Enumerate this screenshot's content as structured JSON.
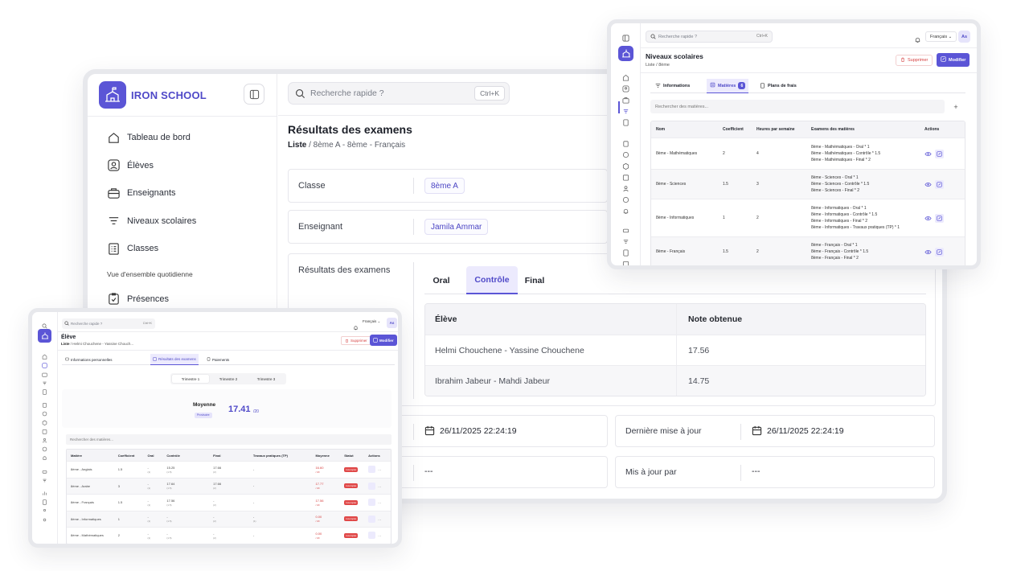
{
  "main": {
    "brand": "IRON SCHOOL",
    "nav": [
      {
        "label": "Tableau de bord",
        "icon": "home-icon"
      },
      {
        "label": "Élèves",
        "icon": "student-icon"
      },
      {
        "label": "Enseignants",
        "icon": "teacher-icon"
      },
      {
        "label": "Niveaux scolaires",
        "icon": "levels-icon"
      },
      {
        "label": "Classes",
        "icon": "classes-icon"
      }
    ],
    "nav_section": "Vue d'ensemble quotidienne",
    "nav_extra": {
      "label": "Présences",
      "icon": "clipboard-icon"
    },
    "search": {
      "placeholder": "Recherche rapide ?",
      "shortcut": "Ctrl+K"
    },
    "page_title": "Résultats des examens",
    "breadcrumb": {
      "root": "Liste",
      "rest": " / 8ème A - 8ème - Français"
    },
    "fields": [
      {
        "label": "Classe",
        "value": "8ème A"
      },
      {
        "label": "Enseignant",
        "value": "Jamila Ammar"
      }
    ],
    "results": {
      "label": "Résultats des examens",
      "tabs": [
        "Oral",
        "Contrôle",
        "Final"
      ],
      "active_tab": "Contrôle",
      "columns": [
        "Élève",
        "Note obtenue"
      ],
      "rows": [
        {
          "student": "Helmi Chouchene - Yassine Chouchene",
          "grade": "17.56"
        },
        {
          "student": "Ibrahim Jabeur - Mahdi Jabeur",
          "grade": "14.75"
        }
      ]
    },
    "meta": {
      "created_value": "26/11/2025 22:24:19",
      "updated_label": "Dernière mise à jour",
      "updated_value": "26/11/2025 22:24:19",
      "created_by_value": "---",
      "updated_by_label": "Mis à jour par",
      "updated_by_value": "---"
    }
  },
  "top_right": {
    "search": {
      "placeholder": "Recherche rapide ?",
      "shortcut": "Ctrl+K"
    },
    "language": "Français",
    "avatar": "As",
    "title": "Niveaux scolaires",
    "breadcrumb": "Liste / 8ème",
    "delete_label": "Supprimer",
    "edit_label": "Modifier",
    "tabs": [
      {
        "label": "Informations",
        "icon": "filter-icon"
      },
      {
        "label": "Matières",
        "icon": "book-icon",
        "count": "6"
      },
      {
        "label": "Plans de frais",
        "icon": "receipt-icon"
      }
    ],
    "active_tab": "Matières",
    "subject_search": "Rechercher des matières...",
    "columns": [
      "Nom",
      "Coefficient",
      "Heures par semaine",
      "Examens des matières",
      "Actions"
    ],
    "rows": [
      {
        "name": "8ème - Mathématiques",
        "coef": "2",
        "hours": "4",
        "exams": [
          "8ème - Mathématiques - Oral * 1",
          "8ème - Mathématiques - Contrôle * 1.5",
          "8ème - Mathématiques - Final * 2"
        ]
      },
      {
        "name": "8ème - Sciences",
        "coef": "1.5",
        "hours": "3",
        "exams": [
          "8ème - Sciences - Oral * 1",
          "8ème - Sciences - Contrôle * 1.5",
          "8ème - Sciences - Final * 2"
        ]
      },
      {
        "name": "8ème - Informatiques",
        "coef": "1",
        "hours": "2",
        "exams": [
          "8ème - Informatiques - Oral * 1",
          "8ème - Informatiques - Contrôle * 1.5",
          "8ème - Informatiques - Final * 2",
          "8ème - Informatiques - Travaux pratiques (TP) * 1"
        ]
      },
      {
        "name": "8ème - Français",
        "coef": "1.5",
        "hours": "2",
        "exams": [
          "8ème - Français - Oral * 1",
          "8ème - Français - Contrôle * 1.5",
          "8ème - Français - Final * 2"
        ]
      }
    ]
  },
  "bottom_left": {
    "search": {
      "placeholder": "Recherche rapide ?",
      "shortcut": "Ctrl+K"
    },
    "language": "Français",
    "avatar": "As",
    "title": "Élève",
    "breadcrumb_root": "Liste",
    "breadcrumb_rest": " / Helmi Chouchene - Yassine Chouch...",
    "delete_label": "Supprimer",
    "edit_label": "Modifier",
    "tabs": [
      {
        "label": "Informations personnelles",
        "icon": "id-icon"
      },
      {
        "label": "Résultats des examens",
        "icon": "results-icon"
      },
      {
        "label": "Paiements",
        "icon": "payment-icon"
      }
    ],
    "active_tab": "Résultats des examens",
    "trimesters": [
      "Trimestre 1",
      "Trimestre 2",
      "Trimestre 3"
    ],
    "active_trimester": "Trimestre 1",
    "average_label": "Moyenne",
    "average_badge": "Provisoire",
    "average_value": "17.41",
    "average_denominator": "/20",
    "subject_search": "Rechercher des matières...",
    "columns": [
      "Matière",
      "Coefficient",
      "Oral",
      "Contrôle",
      "Final",
      "Travaux pratiques (TP)",
      "Moyenne",
      "Statut",
      "Actions"
    ],
    "rows": [
      {
        "subject": "8ème - Anglais",
        "coef": "1.5",
        "oral": "-",
        "oral_sub": "(1)",
        "ctrl": "15.25",
        "ctrl_sub": "(1.5)",
        "final": "17.66",
        "final_sub": "(2)",
        "tp": "-",
        "tp_sub": "",
        "avg": "16.60",
        "avg_sub": "/ 20",
        "status": "Incomplet"
      },
      {
        "subject": "8ème - Arabe",
        "coef": "3",
        "oral": "-",
        "oral_sub": "(1)",
        "ctrl": "17.64",
        "ctrl_sub": "(1.5)",
        "final": "17.66",
        "final_sub": "(2)",
        "tp": "-",
        "tp_sub": "",
        "avg": "17.77",
        "avg_sub": "/ 20",
        "status": "Incomplet"
      },
      {
        "subject": "8ème - Français",
        "coef": "1.5",
        "oral": "-",
        "oral_sub": "(1)",
        "ctrl": "17.56",
        "ctrl_sub": "(1.5)",
        "final": "-",
        "final_sub": "(2)",
        "tp": "-",
        "tp_sub": "",
        "avg": "17.56",
        "avg_sub": "/ 20",
        "status": "Incomplet"
      },
      {
        "subject": "8ème - Informatiques",
        "coef": "1",
        "oral": "-",
        "oral_sub": "(1)",
        "ctrl": "-",
        "ctrl_sub": "(1.5)",
        "final": "-",
        "final_sub": "(2)",
        "tp": "-",
        "tp_sub": "(1)",
        "avg": "0.00",
        "avg_sub": "/ 20",
        "status": "Incomplet"
      },
      {
        "subject": "8ème - Mathématiques",
        "coef": "2",
        "oral": "-",
        "oral_sub": "(1)",
        "ctrl": "-",
        "ctrl_sub": "(1.5)",
        "final": "-",
        "final_sub": "(2)",
        "tp": "-",
        "tp_sub": "",
        "avg": "0.00",
        "avg_sub": "/ 20",
        "status": "Incomplet"
      }
    ]
  },
  "colors": {
    "accent": "#5b55d6",
    "accent_light": "#eceafd",
    "danger": "#d64040"
  }
}
